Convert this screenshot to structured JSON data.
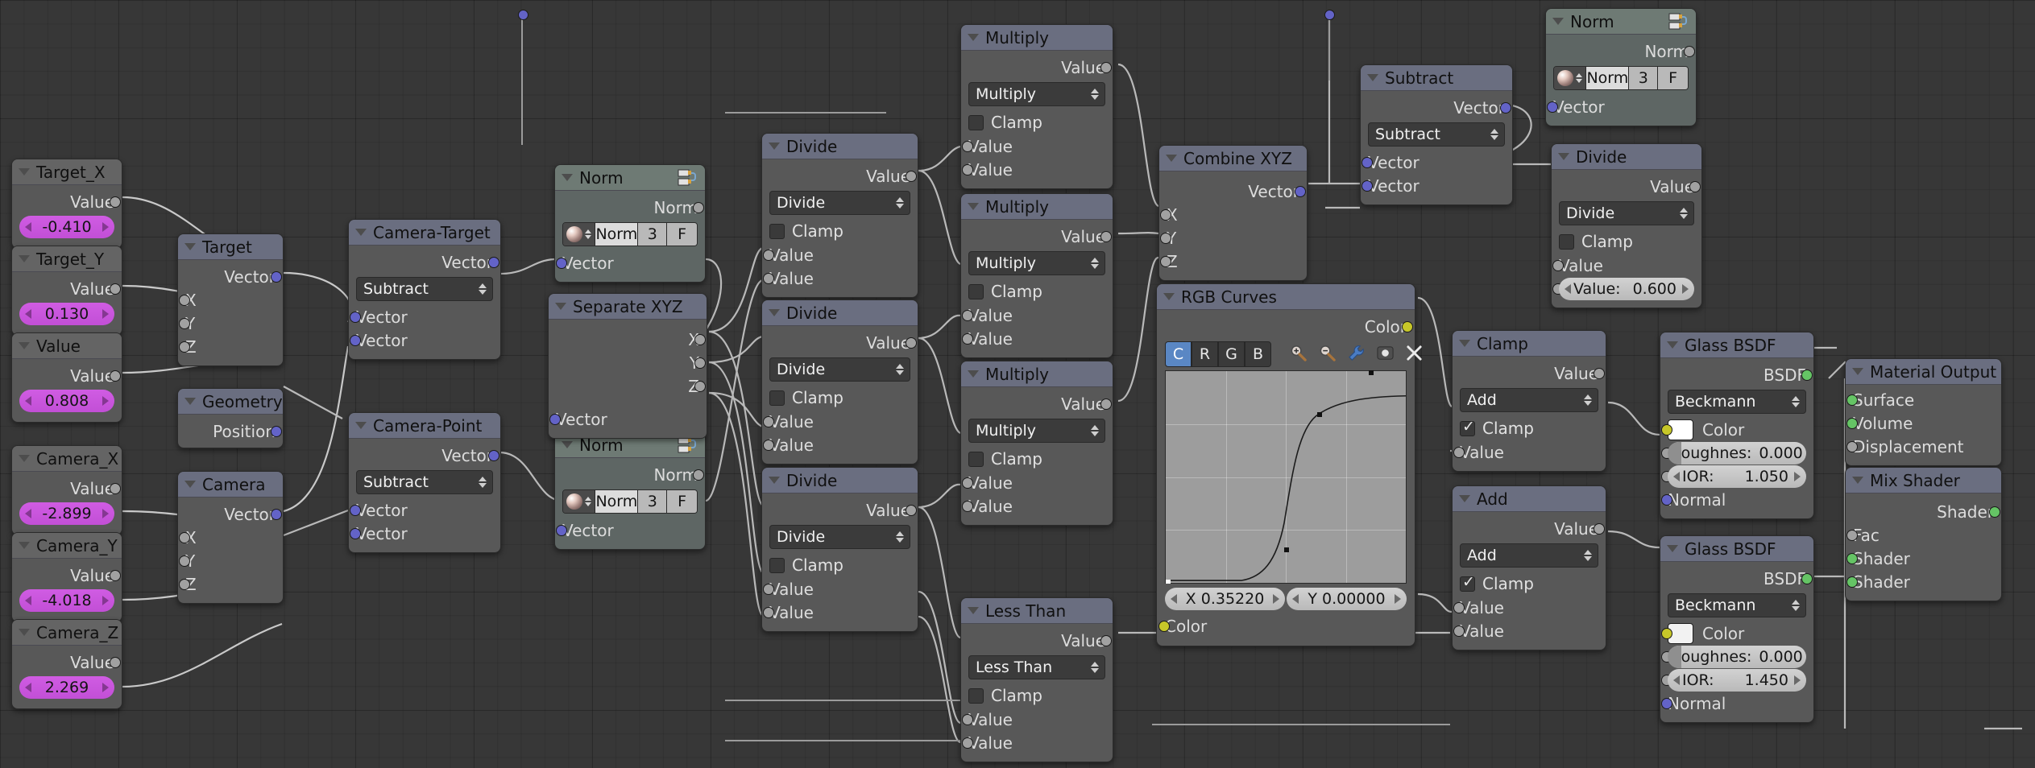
{
  "app": {
    "editor": "Blender Shader Node Editor"
  },
  "palette": {
    "canvas_bg": "#373737",
    "node_bg": "#585858",
    "header_math": "#6a6e80",
    "header_input": "#646464",
    "header_group": "#6e7a74",
    "socket_value": "#a1a1a1",
    "socket_vector": "#6363c7",
    "socket_color": "#c7c729",
    "socket_shader": "#65c465",
    "value_slider": "#d05ce3",
    "accent_selected": "#5a87c4"
  },
  "labels": {
    "value": "Value",
    "vector": "Vector",
    "clamp": "Clamp",
    "color": "Color",
    "normal": "Normal",
    "position": "Position",
    "shader": "Shader",
    "fac": "Fac",
    "bsdf": "BSDF",
    "surface": "Surface",
    "volume": "Volume",
    "displacement": "Displacement",
    "x": "X",
    "y": "Y",
    "z": "Z",
    "norm": "Norm"
  },
  "nodes": {
    "target_x": {
      "title": "Target_X",
      "out": "Value",
      "value": "-0.410"
    },
    "target_y": {
      "title": "Target_Y",
      "out": "Value",
      "value": "0.130"
    },
    "target_z": {
      "title": "Value",
      "out": "Value",
      "value": "0.808"
    },
    "camera_x": {
      "title": "Camera_X",
      "out": "Value",
      "value": "-2.899"
    },
    "camera_y": {
      "title": "Camera_Y",
      "out": "Value",
      "value": "-4.018"
    },
    "camera_z": {
      "title": "Camera_Z",
      "out": "Value",
      "value": "2.269"
    },
    "target": {
      "title": "Target",
      "out": "Vector",
      "inputs": [
        "X",
        "Y",
        "Z"
      ]
    },
    "geometry": {
      "title": "Geometry",
      "out": "Position"
    },
    "camera": {
      "title": "Camera",
      "out": "Vector",
      "inputs": [
        "X",
        "Y",
        "Z"
      ]
    },
    "camera_target": {
      "title": "Camera-Target",
      "out": "Vector",
      "operation": "Subtract",
      "inputs": [
        "Vector",
        "Vector"
      ]
    },
    "camera_point": {
      "title": "Camera-Point",
      "out": "Vector",
      "operation": "Subtract",
      "inputs": [
        "Vector",
        "Vector"
      ]
    },
    "norm_a": {
      "title": "Norm",
      "out": "Norm",
      "widget": {
        "name": "Norm",
        "count": "3",
        "flag": "F"
      },
      "input": "Vector"
    },
    "norm_b": {
      "title": "Norm",
      "out": "Norm",
      "widget": {
        "name": "Norm",
        "count": "3",
        "flag": "F"
      },
      "input": "Vector"
    },
    "norm_c": {
      "title": "Norm",
      "out": "Norm",
      "widget": {
        "name": "Norm",
        "count": "3",
        "flag": "F"
      },
      "input": "Vector"
    },
    "separate_xyz": {
      "title": "Separate XYZ",
      "outputs": [
        "X",
        "Y",
        "Z"
      ],
      "input": "Vector"
    },
    "divide_1": {
      "title": "Divide",
      "out": "Value",
      "operation": "Divide",
      "clamp": false,
      "inputs": [
        "Value",
        "Value"
      ]
    },
    "divide_2": {
      "title": "Divide",
      "out": "Value",
      "operation": "Divide",
      "clamp": false,
      "inputs": [
        "Value",
        "Value"
      ]
    },
    "divide_3": {
      "title": "Divide",
      "out": "Value",
      "operation": "Divide",
      "clamp": false,
      "inputs": [
        "Value",
        "Value"
      ]
    },
    "multiply_1": {
      "title": "Multiply",
      "out": "Value",
      "operation": "Multiply",
      "clamp": false,
      "inputs": [
        "Value",
        "Value"
      ]
    },
    "multiply_2": {
      "title": "Multiply",
      "out": "Value",
      "operation": "Multiply",
      "clamp": false,
      "inputs": [
        "Value",
        "Value"
      ]
    },
    "multiply_3": {
      "title": "Multiply",
      "out": "Value",
      "operation": "Multiply",
      "clamp": false,
      "inputs": [
        "Value",
        "Value"
      ]
    },
    "less_than": {
      "title": "Less Than",
      "out": "Value",
      "operation": "Less Than",
      "clamp": false,
      "inputs": [
        "Value",
        "Value"
      ]
    },
    "combine_xyz": {
      "title": "Combine XYZ",
      "out": "Vector",
      "inputs": [
        "X",
        "Y",
        "Z"
      ]
    },
    "subtract_vec": {
      "title": "Subtract",
      "out": "Vector",
      "operation": "Subtract",
      "inputs": [
        "Vector",
        "Vector"
      ]
    },
    "divide_right": {
      "title": "Divide",
      "out": "Value",
      "operation": "Divide",
      "clamp": false,
      "input_label": "Value",
      "value_label": "Value:",
      "value": "0.600"
    },
    "clamp_node": {
      "title": "Clamp",
      "out": "Value",
      "operation": "Add",
      "clamp": true,
      "inputs": [
        "Value"
      ]
    },
    "add_node": {
      "title": "Add",
      "out": "Value",
      "operation": "Add",
      "clamp": true,
      "inputs": [
        "Value",
        "Value"
      ]
    },
    "rgb_curves": {
      "title": "RGB Curves",
      "out": "Color",
      "channels": [
        "C",
        "R",
        "G",
        "B"
      ],
      "active_channel": "C",
      "tools": [
        "zoom-in-icon",
        "zoom-out-icon",
        "wrench-icon",
        "dot-icon",
        "close-icon"
      ],
      "x_readout": "X 0.35220",
      "y_readout": "Y 0.00000",
      "inputs": [
        "Color"
      ]
    },
    "glass_top": {
      "title": "Glass BSDF",
      "out": "BSDF",
      "distribution": "Beckmann",
      "color_label": "Color",
      "color_swatch": "#ffffff",
      "roughness_label": "Roughnes:",
      "roughness_value": "0.000",
      "ior_label": "IOR:",
      "ior_value": "1.050",
      "normal_label": "Normal"
    },
    "glass_bottom": {
      "title": "Glass BSDF",
      "out": "BSDF",
      "distribution": "Beckmann",
      "color_label": "Color",
      "color_swatch": "#f2f2f2",
      "roughness_label": "Roughnes:",
      "roughness_value": "0.000",
      "ior_label": "IOR:",
      "ior_value": "1.450",
      "normal_label": "Normal"
    },
    "material_output": {
      "title": "Material Output",
      "inputs": [
        "Surface",
        "Volume",
        "Displacement"
      ]
    },
    "mix_shader": {
      "title": "Mix Shader",
      "out": "Shader",
      "inputs": [
        "Fac",
        "Shader",
        "Shader"
      ]
    }
  }
}
